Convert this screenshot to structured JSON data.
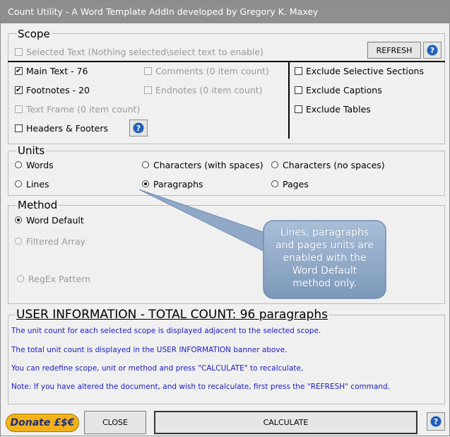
{
  "window": {
    "title": "Count Utility - A Word Template AddIn developed by Gregory K. Maxey"
  },
  "scope": {
    "legend": "Scope",
    "selected_text": {
      "label": "Selected Text (Nothing selected\\select text to enable)",
      "checked": false,
      "enabled": false
    },
    "refresh_label": "REFRESH",
    "main_text": {
      "label": "Main Text - 76",
      "checked": true,
      "enabled": true
    },
    "comments": {
      "label": "Comments (0 item count)",
      "checked": false,
      "enabled": false
    },
    "footnotes": {
      "label": "Footnotes - 20",
      "checked": true,
      "enabled": true
    },
    "endnotes": {
      "label": "Endnotes (0 item count)",
      "checked": false,
      "enabled": false
    },
    "text_frame": {
      "label": "Text Frame (0 item count)",
      "checked": false,
      "enabled": false
    },
    "headers_footers": {
      "label": "Headers & Footers",
      "checked": false,
      "enabled": true
    },
    "exclude_sections": {
      "label": "Exclude Selective Sections",
      "checked": false
    },
    "exclude_captions": {
      "label": "Exclude Captions",
      "checked": false
    },
    "exclude_tables": {
      "label": "Exclude Tables",
      "checked": false
    }
  },
  "units": {
    "legend": "Units",
    "words": "Words",
    "chars_spaces": "Characters (with spaces)",
    "chars_nospaces": "Characters (no spaces)",
    "lines": "Lines",
    "paragraphs": "Paragraphs",
    "pages": "Pages",
    "selected": "Paragraphs"
  },
  "method": {
    "legend": "Method",
    "word_default": "Word Default",
    "filtered_array": "Filtered Array",
    "regex": "RegEx Pattern",
    "selected": "Word Default"
  },
  "callout": {
    "line1": "Lines, paragraphs",
    "line2": "and pages units are",
    "line3": "enabled with the",
    "line4": "Word Default",
    "line5": "method only."
  },
  "user_info": {
    "banner": "USER INFORMATION - TOTAL COUNT: 96 paragraphs",
    "line1": "The unit count for each selected scope is displayed adjacent to the selected scope.",
    "line2": "The total unit count is displayed in the USER INFORMATION banner above.",
    "line3": "You can redefine scope, unit or method and press \"CALCULATE\" to recalculate,",
    "line4": "Note: If you have altered the document, and wish to recalculate, first press the \"REFRESH\" command."
  },
  "footer": {
    "donate": "Donate £$€",
    "close": "CLOSE",
    "calculate": "CALCULATE"
  },
  "colors": {
    "info_text": "#1a1ad0",
    "help_icon": "#1f5fbf",
    "donate_bg": "#f4b21a",
    "callout_bg": "#8fa9c7"
  }
}
